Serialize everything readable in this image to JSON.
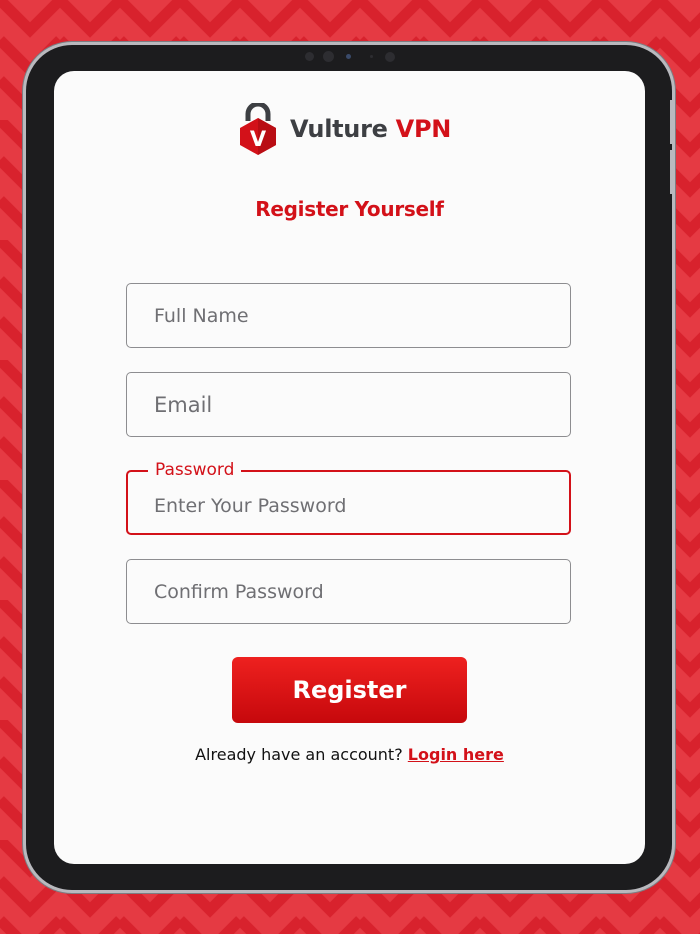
{
  "brand": {
    "name_part1": "Vulture",
    "name_part2": "VPN",
    "logo_letter": "V",
    "logo_icon": "padlock-v-icon",
    "accent_color": "#d31119",
    "background_color": "#e53a43"
  },
  "form": {
    "title": "Register Yourself",
    "fields": [
      {
        "placeholder": "Full Name",
        "value": ""
      },
      {
        "placeholder": "Email",
        "value": ""
      },
      {
        "label": "Password",
        "placeholder": "Enter Your Password",
        "value": "",
        "focused": true
      },
      {
        "placeholder": "Confirm Password",
        "value": ""
      }
    ],
    "submit_label": "Register"
  },
  "footer": {
    "prompt": "Already have an account?",
    "link_label": "Login here"
  }
}
